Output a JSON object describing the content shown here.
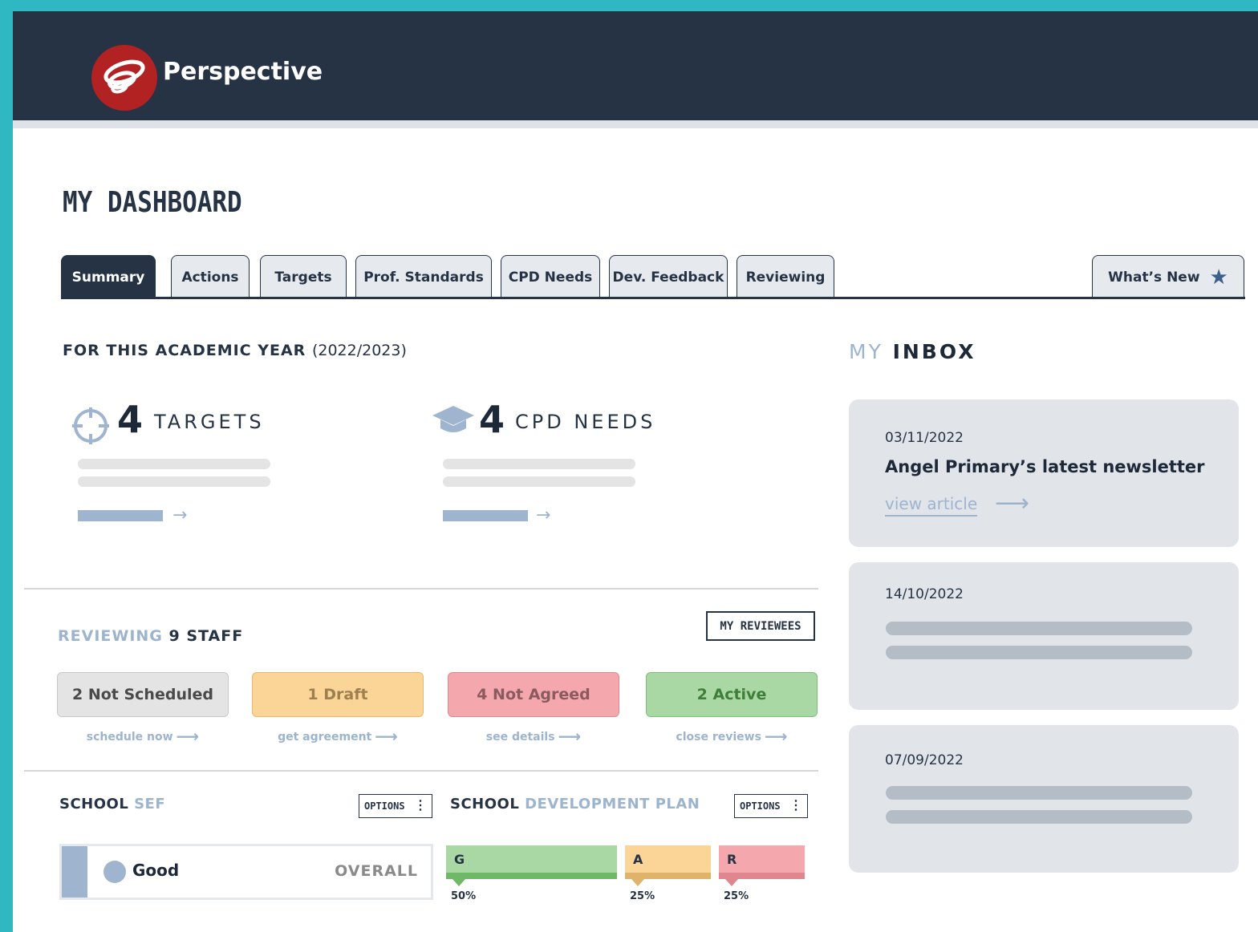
{
  "app": {
    "brand": "Perspective"
  },
  "page": {
    "title": "MY DASHBOARD"
  },
  "tabs": [
    "Summary",
    "Actions",
    "Targets",
    "Prof. Standards",
    "CPD Needs",
    "Dev. Feedback",
    "Reviewing"
  ],
  "whats_new": "What’s New",
  "academic": {
    "heading": "FOR THIS ACADEMIC YEAR",
    "year": "(2022/2023)"
  },
  "stats": {
    "targets": {
      "count": "4",
      "label": "TARGETS"
    },
    "cpd": {
      "count": "4",
      "label": "CPD NEEDS"
    }
  },
  "reviewing": {
    "prefix": "REVIEWING",
    "count_label": "9 STAFF",
    "reviewees_button": "MY REVIEWEES",
    "statuses": [
      {
        "label": "2 Not Scheduled",
        "link": "schedule now"
      },
      {
        "label": "1 Draft",
        "link": "get agreement"
      },
      {
        "label": "4 Not Agreed",
        "link": "see details"
      },
      {
        "label": "2 Active",
        "link": "close reviews"
      }
    ]
  },
  "sef": {
    "heading_a": "SCHOOL",
    "heading_b": "SEF",
    "options": "OPTIONS",
    "rating": "Good",
    "overall": "OVERALL"
  },
  "sdp": {
    "heading_a": "SCHOOL",
    "heading_b": "DEVELOPMENT PLAN",
    "options": "OPTIONS",
    "segments": [
      {
        "letter": "G",
        "pct": "50%",
        "value": 50,
        "color": "#a9d8a4",
        "under": "#6fb868"
      },
      {
        "letter": "A",
        "pct": "25%",
        "value": 25,
        "color": "#fbd598",
        "under": "#dfb36a"
      },
      {
        "letter": "R",
        "pct": "25%",
        "value": 25,
        "color": "#f4a7ac",
        "under": "#e0868e"
      }
    ]
  },
  "inbox": {
    "heading_a": "MY",
    "heading_b": "INBOX",
    "messages": [
      {
        "date": "03/11/2022",
        "title": "Angel Primary’s latest newsletter",
        "link": "view article"
      },
      {
        "date": "14/10/2022"
      },
      {
        "date": "07/09/2022"
      }
    ]
  }
}
